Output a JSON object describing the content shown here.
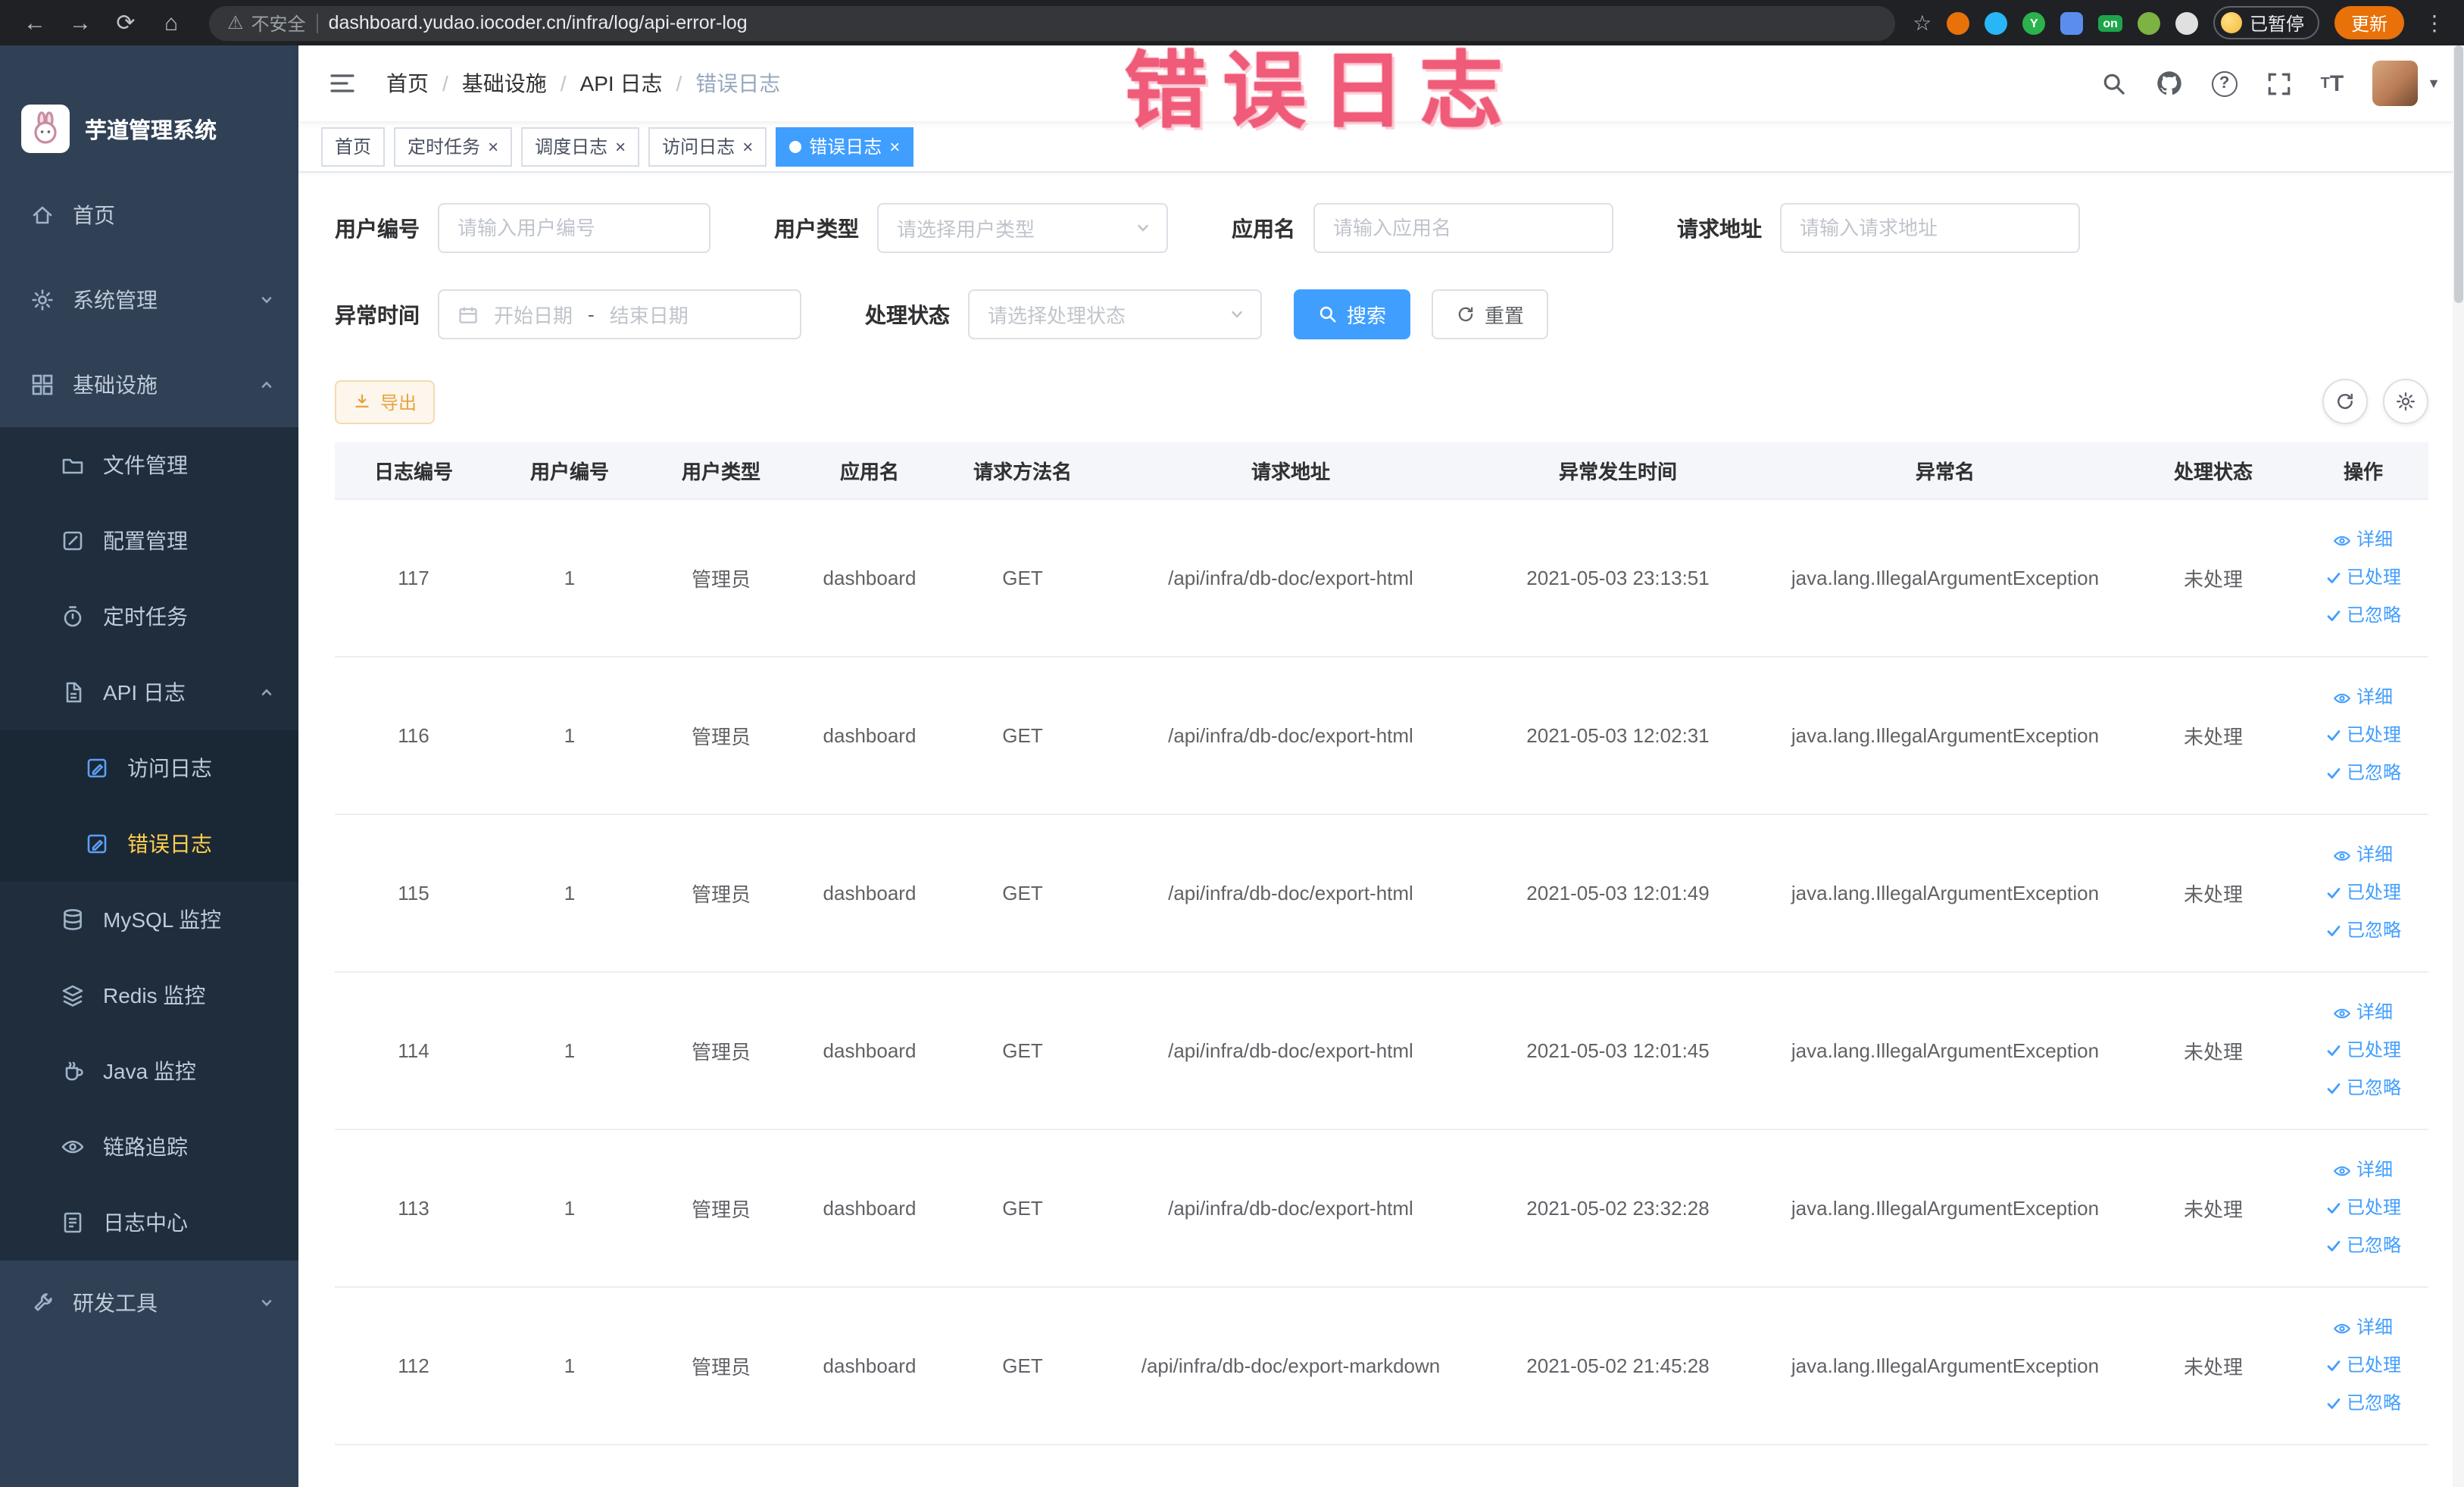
{
  "browser": {
    "security_label": "不安全",
    "url": "dashboard.yudao.iocoder.cn/infra/log/api-error-log",
    "on_badge": "on",
    "ext_y_badge": "Y",
    "paused_badge": "已暂停",
    "update_button": "更新"
  },
  "watermark": "错误日志",
  "sidebar": {
    "title": "芋道管理系统",
    "menu": [
      {
        "label": "首页"
      },
      {
        "label": "系统管理"
      },
      {
        "label": "基础设施"
      },
      {
        "label": "文件管理"
      },
      {
        "label": "配置管理"
      },
      {
        "label": "定时任务"
      },
      {
        "label": "API 日志"
      },
      {
        "label": "访问日志"
      },
      {
        "label": "错误日志"
      },
      {
        "label": "MySQL 监控"
      },
      {
        "label": "Redis 监控"
      },
      {
        "label": "Java 监控"
      },
      {
        "label": "链路追踪"
      },
      {
        "label": "日志中心"
      },
      {
        "label": "研发工具"
      }
    ]
  },
  "header": {
    "breadcrumb": [
      "首页",
      "基础设施",
      "API 日志",
      "错误日志"
    ]
  },
  "tags": [
    {
      "label": "首页"
    },
    {
      "label": "定时任务"
    },
    {
      "label": "调度日志"
    },
    {
      "label": "访问日志"
    },
    {
      "label": "错误日志"
    }
  ],
  "filters": {
    "user_id_label": "用户编号",
    "user_id_placeholder": "请输入用户编号",
    "user_type_label": "用户类型",
    "user_type_placeholder": "请选择用户类型",
    "app_name_label": "应用名",
    "app_name_placeholder": "请输入应用名",
    "request_url_label": "请求地址",
    "request_url_placeholder": "请输入请求地址",
    "exception_time_label": "异常时间",
    "date_start_placeholder": "开始日期",
    "date_separator": "-",
    "date_end_placeholder": "结束日期",
    "process_status_label": "处理状态",
    "process_status_placeholder": "请选择处理状态",
    "search_button": "搜索",
    "reset_button": "重置"
  },
  "toolbar": {
    "export_button": "导出"
  },
  "table": {
    "columns": [
      "日志编号",
      "用户编号",
      "用户类型",
      "应用名",
      "请求方法名",
      "请求地址",
      "异常发生时间",
      "异常名",
      "处理状态",
      "操作"
    ],
    "actions": {
      "detail": "详细",
      "processed": "已处理",
      "ignored": "已忽略"
    },
    "rows": [
      {
        "id": "117",
        "user_id": "1",
        "user_type": "管理员",
        "app": "dashboard",
        "method": "GET",
        "url": "/api/infra/db-doc/export-html",
        "time": "2021-05-03 23:13:51",
        "exception": "java.lang.IllegalArgumentException",
        "status": "未处理"
      },
      {
        "id": "116",
        "user_id": "1",
        "user_type": "管理员",
        "app": "dashboard",
        "method": "GET",
        "url": "/api/infra/db-doc/export-html",
        "time": "2021-05-03 12:02:31",
        "exception": "java.lang.IllegalArgumentException",
        "status": "未处理"
      },
      {
        "id": "115",
        "user_id": "1",
        "user_type": "管理员",
        "app": "dashboard",
        "method": "GET",
        "url": "/api/infra/db-doc/export-html",
        "time": "2021-05-03 12:01:49",
        "exception": "java.lang.IllegalArgumentException",
        "status": "未处理"
      },
      {
        "id": "114",
        "user_id": "1",
        "user_type": "管理员",
        "app": "dashboard",
        "method": "GET",
        "url": "/api/infra/db-doc/export-html",
        "time": "2021-05-03 12:01:45",
        "exception": "java.lang.IllegalArgumentException",
        "status": "未处理"
      },
      {
        "id": "113",
        "user_id": "1",
        "user_type": "管理员",
        "app": "dashboard",
        "method": "GET",
        "url": "/api/infra/db-doc/export-html",
        "time": "2021-05-02 23:32:28",
        "exception": "java.lang.IllegalArgumentException",
        "status": "未处理"
      },
      {
        "id": "112",
        "user_id": "1",
        "user_type": "管理员",
        "app": "dashboard",
        "method": "GET",
        "url": "/api/infra/db-doc/export-markdown",
        "time": "2021-05-02 21:45:28",
        "exception": "java.lang.IllegalArgumentException",
        "status": "未处理"
      }
    ]
  }
}
